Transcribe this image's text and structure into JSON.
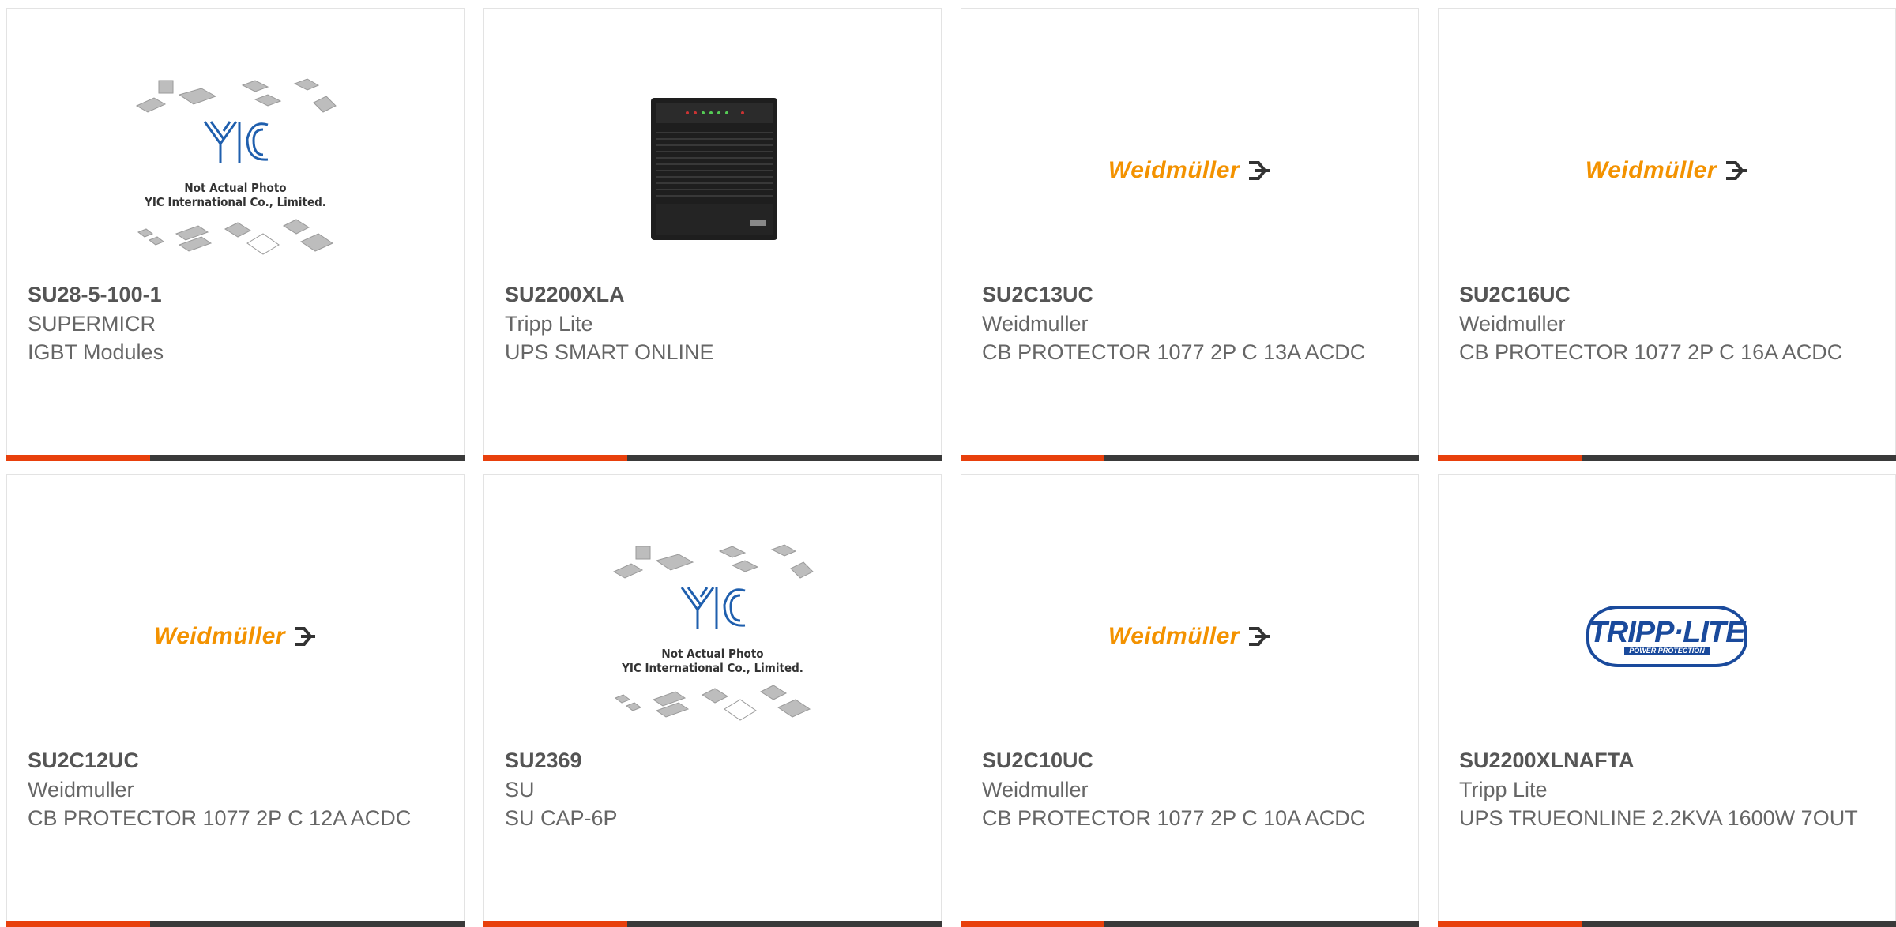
{
  "placeholder": {
    "line1": "Not Actual Photo",
    "line2": "YIC International Co., Limited.",
    "logo": "YIC"
  },
  "logos": {
    "weidmuller": "Weidmüller",
    "tripplite_main": "TRIPP·LITE",
    "tripplite_sub": "POWER PROTECTION"
  },
  "colors": {
    "accent": "#e8400c",
    "bar": "#3a3a3a",
    "weidmuller": "#f39200",
    "tripplite": "#1a4a9c"
  },
  "products": [
    {
      "part": "SU28-5-100-1",
      "manufacturer": "SUPERMICR",
      "description": "IGBT Modules",
      "image": "placeholder"
    },
    {
      "part": "SU2200XLA",
      "manufacturer": "Tripp Lite",
      "description": "UPS SMART ONLINE",
      "image": "ups-photo"
    },
    {
      "part": "SU2C13UC",
      "manufacturer": "Weidmuller",
      "description": "CB PROTECTOR 1077 2P C 13A ACDC",
      "image": "weidmuller-logo"
    },
    {
      "part": "SU2C16UC",
      "manufacturer": "Weidmuller",
      "description": "CB PROTECTOR 1077 2P C 16A ACDC",
      "image": "weidmuller-logo"
    },
    {
      "part": "SU2C12UC",
      "manufacturer": "Weidmuller",
      "description": "CB PROTECTOR 1077 2P C 12A ACDC",
      "image": "weidmuller-logo"
    },
    {
      "part": "SU2369",
      "manufacturer": "SU",
      "description": "SU CAP-6P",
      "image": "placeholder"
    },
    {
      "part": "SU2C10UC",
      "manufacturer": "Weidmuller",
      "description": "CB PROTECTOR 1077 2P C 10A ACDC",
      "image": "weidmuller-logo"
    },
    {
      "part": "SU2200XLNAFTA",
      "manufacturer": "Tripp Lite",
      "description": "UPS TRUEONLINE 2.2KVA 1600W 7OUT",
      "image": "tripplite-logo"
    }
  ]
}
